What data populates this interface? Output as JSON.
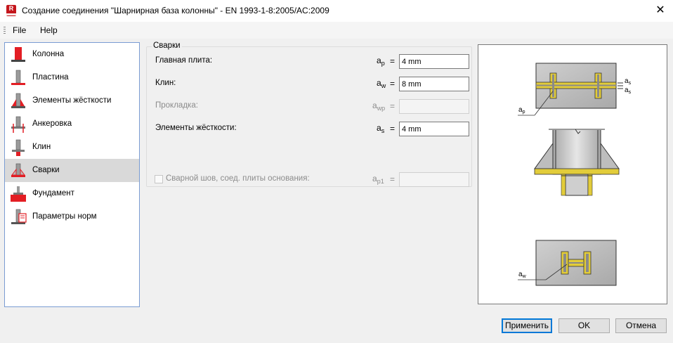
{
  "window": {
    "app_icon_letter": "R",
    "title": "Создание соединения \"Шарнирная база колонны\" - EN 1993-1-8:2005/AC:2009",
    "close_glyph": "✕"
  },
  "menu": {
    "file": "File",
    "help": "Help"
  },
  "nav": {
    "items": [
      {
        "label": "Колонна",
        "icon": "column-icon"
      },
      {
        "label": "Пластина",
        "icon": "plate-icon"
      },
      {
        "label": "Элементы жёсткости",
        "icon": "stiffeners-icon"
      },
      {
        "label": "Анкеровка",
        "icon": "anchorage-icon"
      },
      {
        "label": "Клин",
        "icon": "wedge-icon"
      },
      {
        "label": "Сварки",
        "icon": "welds-icon",
        "selected": true
      },
      {
        "label": "Фундамент",
        "icon": "foundation-icon"
      },
      {
        "label": "Параметры норм",
        "icon": "code-params-icon"
      }
    ]
  },
  "welds": {
    "group_title": "Сварки",
    "main_plate": {
      "label": "Главная плита:",
      "sym": "a",
      "sub": "p",
      "eq": "=",
      "value": "4 mm"
    },
    "wedge": {
      "label": "Клин:",
      "sym": "a",
      "sub": "w",
      "eq": "=",
      "value": "8 mm"
    },
    "shim": {
      "label": "Прокладка:",
      "sym": "a",
      "sub": "wp",
      "eq": "=",
      "value": "",
      "disabled": true
    },
    "stiffeners": {
      "label": "Элементы жёсткости:",
      "sym": "a",
      "sub": "s",
      "eq": "=",
      "value": "4 mm"
    },
    "base_plate_weld": {
      "label": "Сварной шов, соед. плиты основания:",
      "sym": "a",
      "sub": "p1",
      "eq": "=",
      "value": "",
      "checked": false,
      "disabled": true
    }
  },
  "preview": {
    "labels": {
      "ap": "a",
      "ap_sub": "p",
      "aw": "a",
      "aw_sub": "w",
      "as1": "a",
      "as1_sub": "s",
      "as2": "a",
      "as2_sub": "s"
    }
  },
  "buttons": {
    "apply": "Применить",
    "ok": "OK",
    "cancel": "Отмена"
  },
  "colors": {
    "accent": "#0078d7",
    "red": "#e31e24",
    "weld": "#e2cc3a",
    "steel": "#b0b0b0"
  }
}
